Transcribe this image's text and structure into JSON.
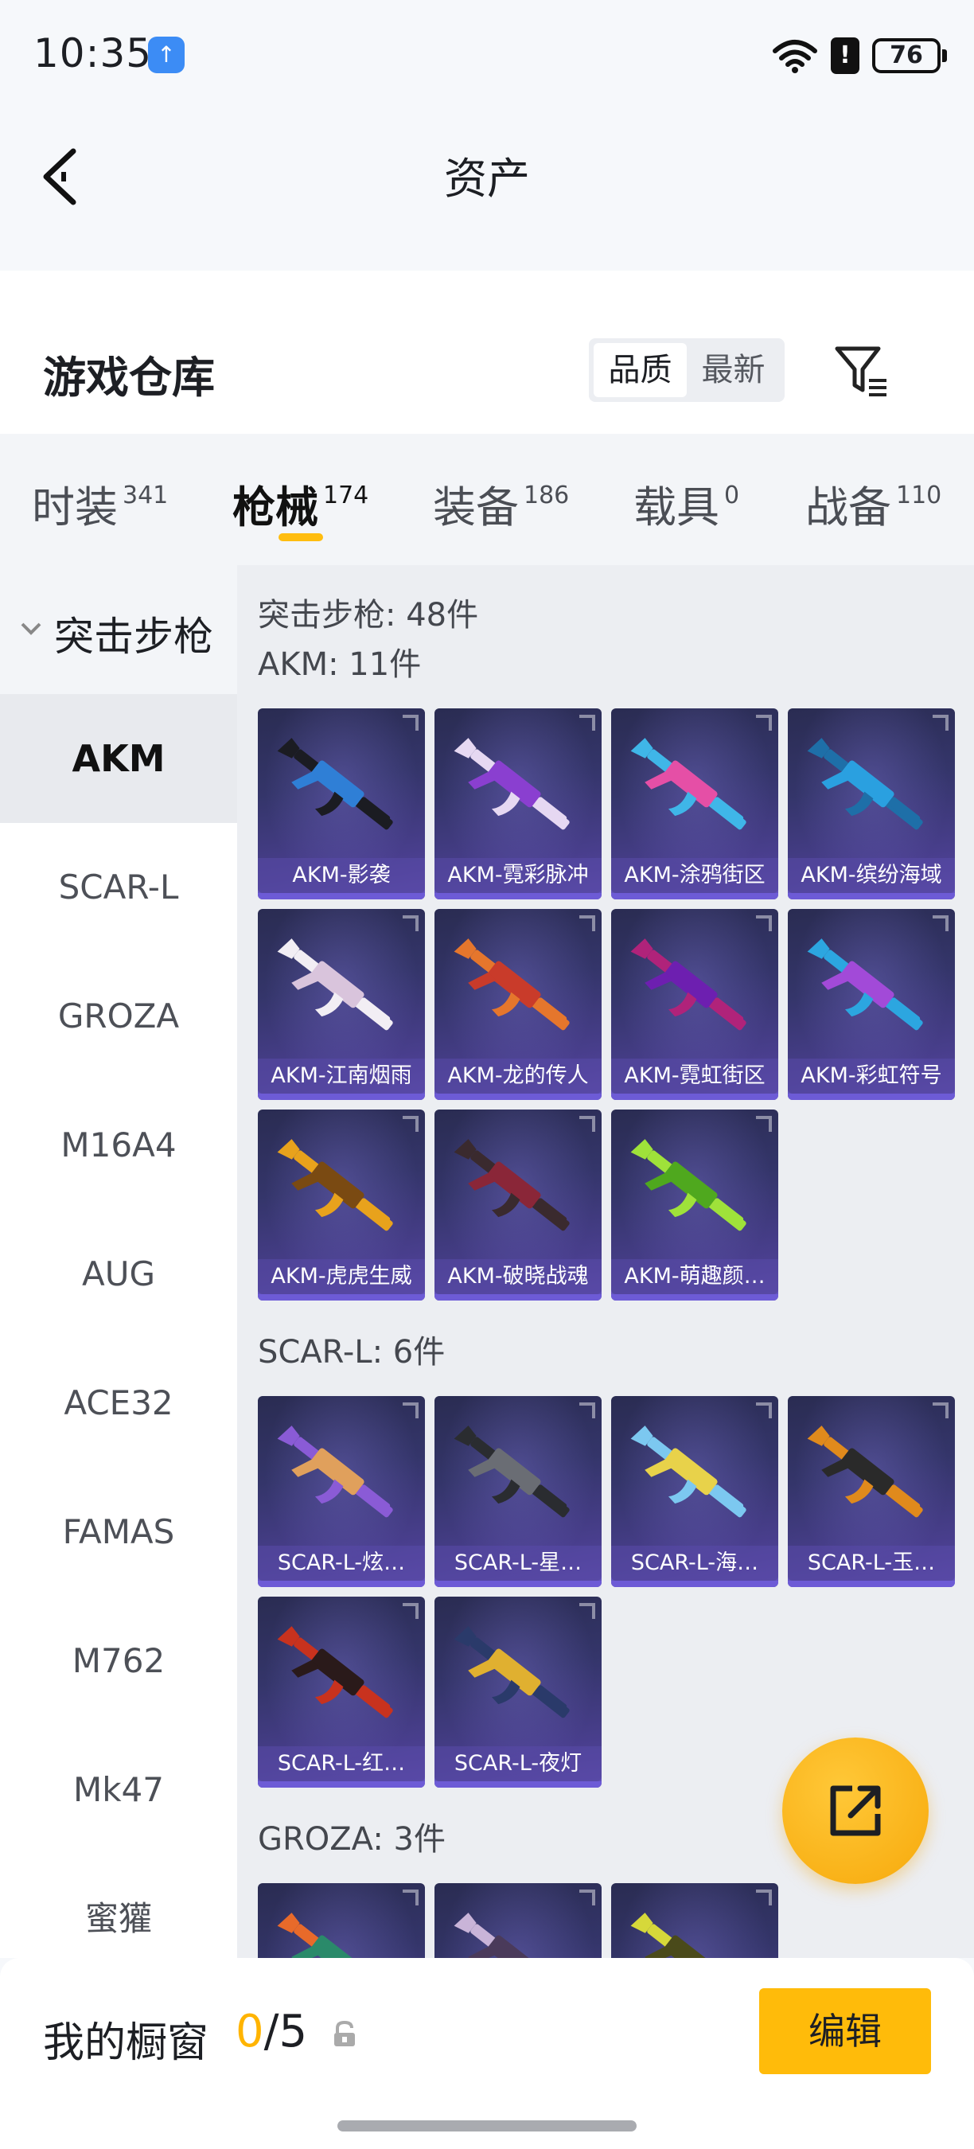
{
  "status_bar": {
    "time": "10:35",
    "battery": "76",
    "notification_icon": "upload-icon"
  },
  "header": {
    "title": "资产"
  },
  "warehouse": {
    "title": "游戏仓库",
    "sort_options": [
      "品质",
      "最新"
    ],
    "active_sort": "品质"
  },
  "tabs": [
    {
      "label": "时装",
      "count": "341"
    },
    {
      "label": "枪械",
      "count": "174",
      "active": true
    },
    {
      "label": "装备",
      "count": "186"
    },
    {
      "label": "载具",
      "count": "0"
    },
    {
      "label": "战备",
      "count": "110"
    }
  ],
  "sidebar": {
    "group": "突击步枪",
    "items": [
      "AKM",
      "SCAR-L",
      "GROZA",
      "M16A4",
      "AUG",
      "ACE32",
      "FAMAS",
      "M762",
      "Mk47",
      "蜜獾"
    ],
    "active": "AKM"
  },
  "main": {
    "total": "突击步枪: 48件",
    "groups": [
      {
        "title": "AKM: 11件",
        "items": [
          "AKM-影袭",
          "AKM-霓彩脉冲",
          "AKM-涂鸦街区",
          "AKM-缤纷海域",
          "AKM-江南烟雨",
          "AKM-龙的传人",
          "AKM-霓虹街区",
          "AKM-彩虹符号",
          "AKM-虎虎生威",
          "AKM-破晓战魂",
          "AKM-萌趣颜…"
        ]
      },
      {
        "title": "SCAR-L: 6件",
        "items": [
          "SCAR-L-炫…",
          "SCAR-L-星…",
          "SCAR-L-海…",
          "SCAR-L-玉…",
          "SCAR-L-红…",
          "SCAR-L-夜灯"
        ]
      },
      {
        "title": "GROZA: 3件",
        "items": [
          "",
          "",
          ""
        ]
      }
    ]
  },
  "bottom": {
    "label": "我的橱窗",
    "used": "0",
    "total": "/5",
    "edit": "编辑"
  },
  "colors": {
    "accent": "#ffbb0a",
    "card": "#3a3775",
    "card_band": "#6d5bd6"
  }
}
